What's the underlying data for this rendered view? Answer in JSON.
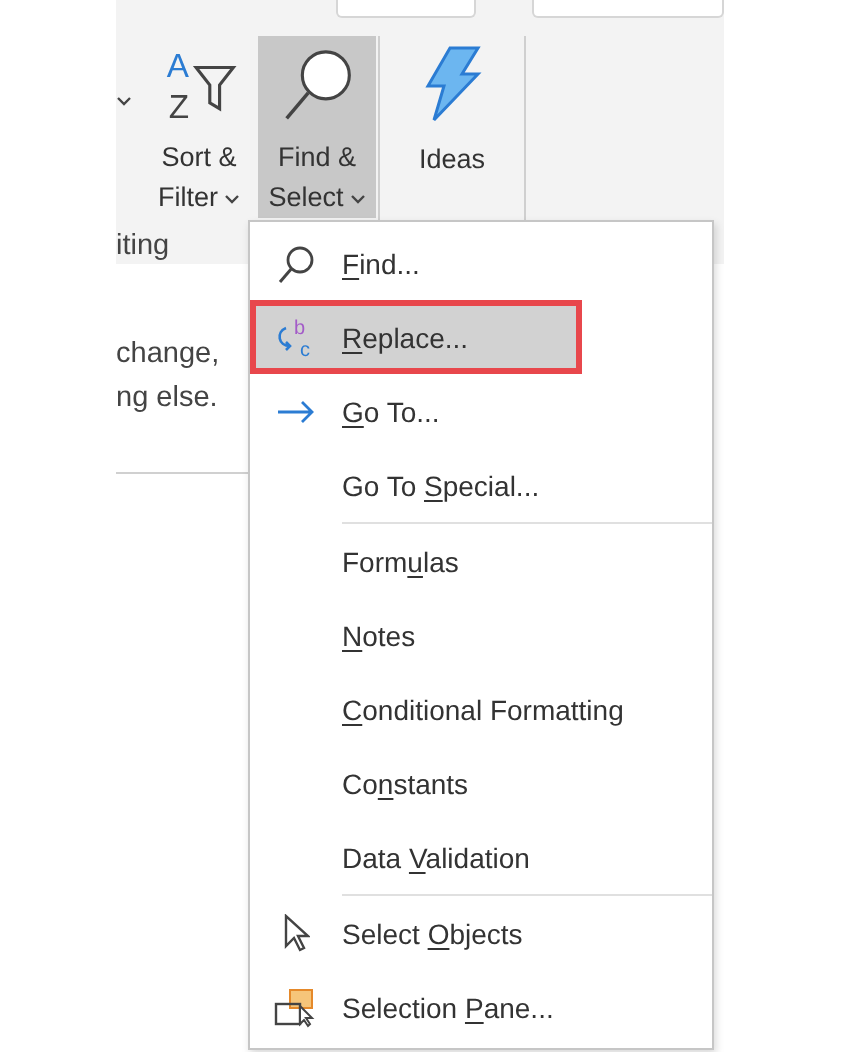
{
  "ribbon": {
    "buttons": [
      {
        "kind": "sort",
        "lines": [
          "Sort &",
          "Filter"
        ],
        "dropdown": true,
        "selected": false,
        "icon_text": [
          "A",
          "Z"
        ]
      },
      {
        "kind": "find",
        "lines": [
          "Find &",
          "Select"
        ],
        "dropdown": true,
        "selected": true
      },
      {
        "kind": "ideas",
        "lines": [
          "Ideas"
        ],
        "dropdown": false,
        "selected": false
      }
    ],
    "group_label": "iting"
  },
  "tooltip": {
    "lines": [
      "change,",
      "ng else."
    ]
  },
  "menu": {
    "items": [
      {
        "kind": "find",
        "key": "F",
        "post": "ind...",
        "selected": false
      },
      {
        "kind": "replace",
        "icon_text": [
          "b",
          "c"
        ],
        "key": "R",
        "post": "eplace...",
        "selected": true
      },
      {
        "kind": "goto",
        "key": "G",
        "post": "o To...",
        "selected": false
      },
      {
        "kind": "plain",
        "pre": "Go To ",
        "key": "S",
        "post": "pecial...",
        "selected": false
      },
      {
        "kind": "separator"
      },
      {
        "kind": "plain",
        "pre": "Form",
        "key": "u",
        "post": "las",
        "selected": false
      },
      {
        "kind": "plain",
        "key": "N",
        "post": "otes",
        "selected": false
      },
      {
        "kind": "plain",
        "key": "C",
        "post": "onditional Formatting",
        "selected": false
      },
      {
        "kind": "plain",
        "pre": "Co",
        "key": "n",
        "post": "stants",
        "selected": false
      },
      {
        "kind": "plain",
        "pre": "Data ",
        "key": "V",
        "post": "alidation",
        "selected": false
      },
      {
        "kind": "separator"
      },
      {
        "kind": "objects",
        "pre": "Select ",
        "key": "O",
        "post": "bjects",
        "selected": false
      },
      {
        "kind": "pane",
        "pre": "Selection ",
        "key": "P",
        "post": "ane...",
        "selected": false
      }
    ]
  }
}
